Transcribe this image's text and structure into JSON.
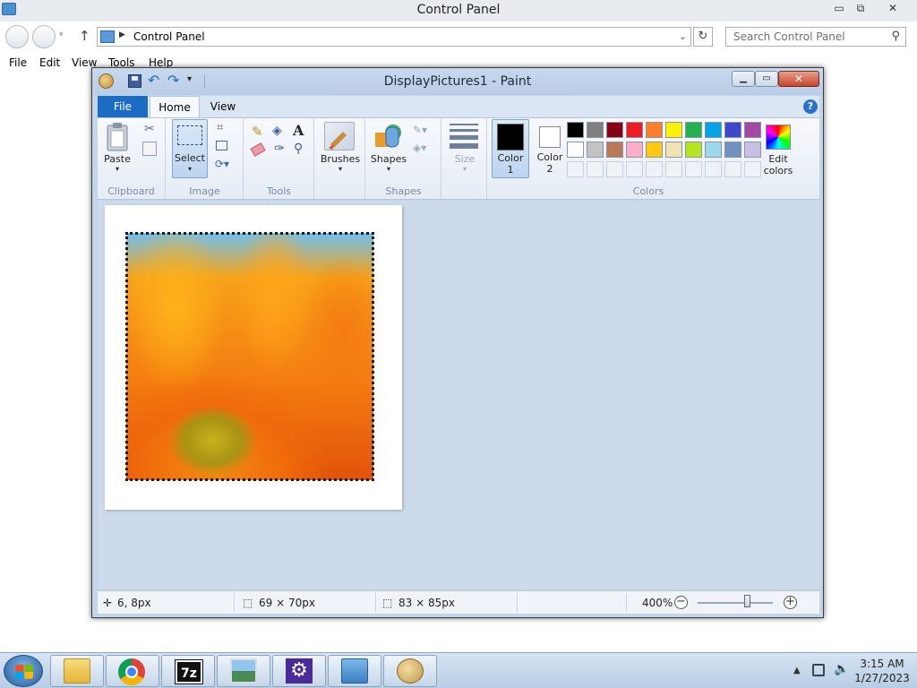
{
  "control_panel": {
    "title": "Control Panel",
    "address": "Control Panel",
    "search_placeholder": "Search Control Panel",
    "menu": [
      "File",
      "Edit",
      "View",
      "Tools",
      "Help"
    ],
    "window_buttons": {
      "minimize": "▭",
      "restore": "⧉",
      "close": "✕"
    }
  },
  "paint": {
    "title": "DisplayPictures1 - Paint",
    "tabs": {
      "file": "File",
      "home": "Home",
      "view": "View"
    },
    "help": "?",
    "groups": {
      "clipboard": {
        "label": "Clipboard",
        "paste": "Paste"
      },
      "image": {
        "label": "Image",
        "select": "Select"
      },
      "tools": {
        "label": "Tools"
      },
      "brushes": {
        "label": "Brushes"
      },
      "shapes": {
        "label": "Shapes",
        "button": "Shapes"
      },
      "size": {
        "label": "Size"
      },
      "colors": {
        "label": "Colors",
        "color1_line1": "Color",
        "color1_line2": "1",
        "color2_line1": "Color",
        "color2_line2": "2",
        "edit_line1": "Edit",
        "edit_line2": "colors",
        "color1_value": "#000000",
        "color2_value": "#ffffff",
        "palette_row1": [
          "#000000",
          "#7f7f7f",
          "#880015",
          "#ed1c24",
          "#ff7f27",
          "#fff200",
          "#22b14c",
          "#00a2e8",
          "#3f48cc",
          "#a349a4"
        ],
        "palette_row2": [
          "#ffffff",
          "#c3c3c3",
          "#b97a57",
          "#ffaec9",
          "#ffc90e",
          "#efe4b0",
          "#b5e61d",
          "#99d9ea",
          "#7092be",
          "#c8bfe7"
        ],
        "palette_row3": [
          "#eef1f5",
          "#eef1f5",
          "#eef1f5",
          "#eef1f5",
          "#eef1f5",
          "#eef1f5",
          "#eef1f5",
          "#eef1f5",
          "#eef1f5",
          "#eef1f5"
        ]
      }
    },
    "status": {
      "cursor_position": "6, 8px",
      "selection_size": "69 × 70px",
      "image_size": "83 × 85px",
      "zoom": "400%",
      "zoom_minus": "−",
      "zoom_plus": "+"
    }
  },
  "taskbar": {
    "apps": [
      "file-explorer",
      "chrome",
      "7-zip",
      "photo-viewer",
      "settings",
      "control-panel",
      "paint"
    ],
    "seven_zip_label": "7z",
    "clock_time": "3:15 AM",
    "clock_date": "1/27/2023"
  }
}
